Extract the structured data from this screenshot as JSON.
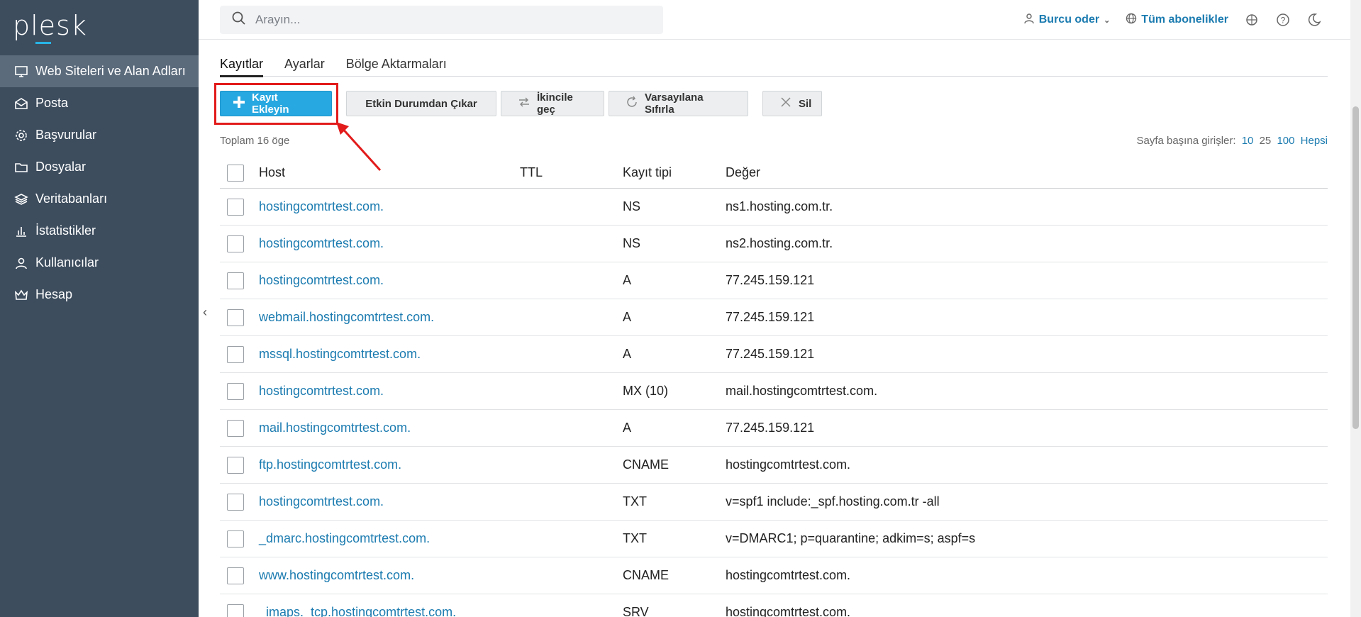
{
  "brand": {
    "logo_text": "plesk",
    "accent": "#27b4e6"
  },
  "sidebar": {
    "items": [
      {
        "label": "Web Siteleri ve Alan Adları",
        "icon": "monitor-icon",
        "active": true
      },
      {
        "label": "Posta",
        "icon": "envelope-icon"
      },
      {
        "label": "Başvurular",
        "icon": "gear-icon"
      },
      {
        "label": "Dosyalar",
        "icon": "folder-icon"
      },
      {
        "label": "Veritabanları",
        "icon": "database-icon"
      },
      {
        "label": "İstatistikler",
        "icon": "chart-icon"
      },
      {
        "label": "Kullanıcılar",
        "icon": "user-icon"
      },
      {
        "label": "Hesap",
        "icon": "crown-icon"
      }
    ]
  },
  "header": {
    "search_placeholder": "Arayın...",
    "user_label": "Burcu oder",
    "subscriptions_label": "Tüm abonelikler"
  },
  "tabs": [
    {
      "label": "Kayıtlar",
      "active": true
    },
    {
      "label": "Ayarlar"
    },
    {
      "label": "Bölge Aktarmaları"
    }
  ],
  "toolbar": {
    "add_label": "Kayıt Ekleyin",
    "disable_label": "Etkin Durumdan Çıkar",
    "secondary_label": "İkincile geç",
    "reset_label": "Varsayılana Sıfırla",
    "delete_label": "Sil"
  },
  "summary": {
    "total": "Toplam 16 öge",
    "per_page_label": "Sayfa başına girişler:",
    "per_page_options": [
      "10",
      "25",
      "100",
      "Hepsi"
    ]
  },
  "table": {
    "columns": {
      "host": "Host",
      "ttl": "TTL",
      "type": "Kayıt tipi",
      "value": "Değer"
    },
    "rows": [
      {
        "host": "hostingcomtrtest.com.",
        "ttl": "",
        "type": "NS",
        "value": "ns1.hosting.com.tr."
      },
      {
        "host": "hostingcomtrtest.com.",
        "ttl": "",
        "type": "NS",
        "value": "ns2.hosting.com.tr."
      },
      {
        "host": "hostingcomtrtest.com.",
        "ttl": "",
        "type": "A",
        "value": "77.245.159.121"
      },
      {
        "host": "webmail.hostingcomtrtest.com.",
        "ttl": "",
        "type": "A",
        "value": "77.245.159.121"
      },
      {
        "host": "mssql.hostingcomtrtest.com.",
        "ttl": "",
        "type": "A",
        "value": "77.245.159.121"
      },
      {
        "host": "hostingcomtrtest.com.",
        "ttl": "",
        "type": "MX (10)",
        "value": "mail.hostingcomtrtest.com."
      },
      {
        "host": "mail.hostingcomtrtest.com.",
        "ttl": "",
        "type": "A",
        "value": "77.245.159.121"
      },
      {
        "host": "ftp.hostingcomtrtest.com.",
        "ttl": "",
        "type": "CNAME",
        "value": "hostingcomtrtest.com."
      },
      {
        "host": "hostingcomtrtest.com.",
        "ttl": "",
        "type": "TXT",
        "value": "v=spf1 include:_spf.hosting.com.tr -all"
      },
      {
        "host": "_dmarc.hostingcomtrtest.com.",
        "ttl": "",
        "type": "TXT",
        "value": "v=DMARC1; p=quarantine; adkim=s; aspf=s"
      },
      {
        "host": "www.hostingcomtrtest.com.",
        "ttl": "",
        "type": "CNAME",
        "value": "hostingcomtrtest.com."
      },
      {
        "host": "_imaps._tcp.hostingcomtrtest.com.",
        "ttl": "",
        "type": "SRV",
        "value": "hostingcomtrtest.com."
      }
    ]
  }
}
